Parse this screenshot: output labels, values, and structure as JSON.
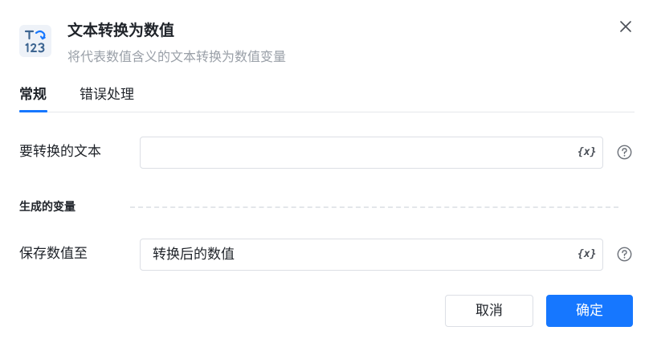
{
  "dialog": {
    "title": "文本转换为数值",
    "subtitle": "将代表数值含义的文本转换为数值变量",
    "icon": "text-to-number-icon"
  },
  "tabs": [
    {
      "label": "常规",
      "active": true
    },
    {
      "label": "错误处理",
      "active": false
    }
  ],
  "fields": {
    "input_text": {
      "label": "要转换的文本",
      "value": "",
      "var_icon_text": "{x}"
    },
    "output_section": {
      "label": "生成的变量"
    },
    "save_to": {
      "label": "保存数值至",
      "value": "转换后的数值",
      "var_icon_text": "{x}"
    }
  },
  "buttons": {
    "cancel": "取消",
    "ok": "确定"
  },
  "colors": {
    "primary": "#1677ff",
    "text": "#1f2329",
    "muted": "#9aa0a8",
    "border": "#dcdfe5",
    "icon_bg": "#eef2f8"
  }
}
